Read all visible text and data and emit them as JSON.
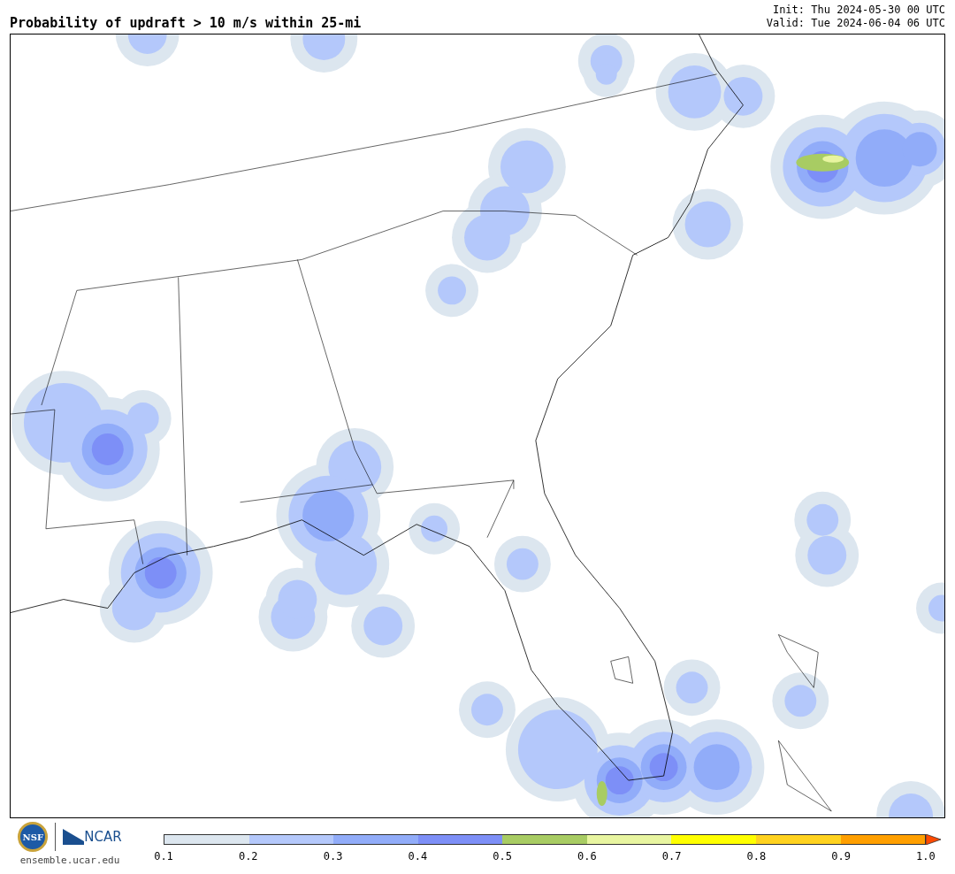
{
  "title": "Probability of updraft > 10 m/s within 25-mi",
  "init": "Init: Thu 2024-05-30 00 UTC",
  "valid": "Valid: Tue 2024-06-04 06 UTC",
  "logos": {
    "nsf": "NSF",
    "ncar": "NCAR"
  },
  "site": "ensemble.ucar.edu",
  "colorbar": {
    "bins": [
      {
        "color": "#dce6ef"
      },
      {
        "color": "#b4c8fb"
      },
      {
        "color": "#91acf9"
      },
      {
        "color": "#7d8ff7"
      },
      {
        "color": "#a8cc63"
      },
      {
        "color": "#e8f5a0"
      },
      {
        "color": "#ffff00"
      },
      {
        "color": "#ffd21f"
      },
      {
        "color": "#ff9f00"
      }
    ],
    "over": {
      "color": "#ff4a00"
    },
    "ticks": [
      "0.1",
      "0.2",
      "0.3",
      "0.4",
      "0.5",
      "0.6",
      "0.7",
      "0.8",
      "0.9",
      "1.0"
    ]
  }
}
